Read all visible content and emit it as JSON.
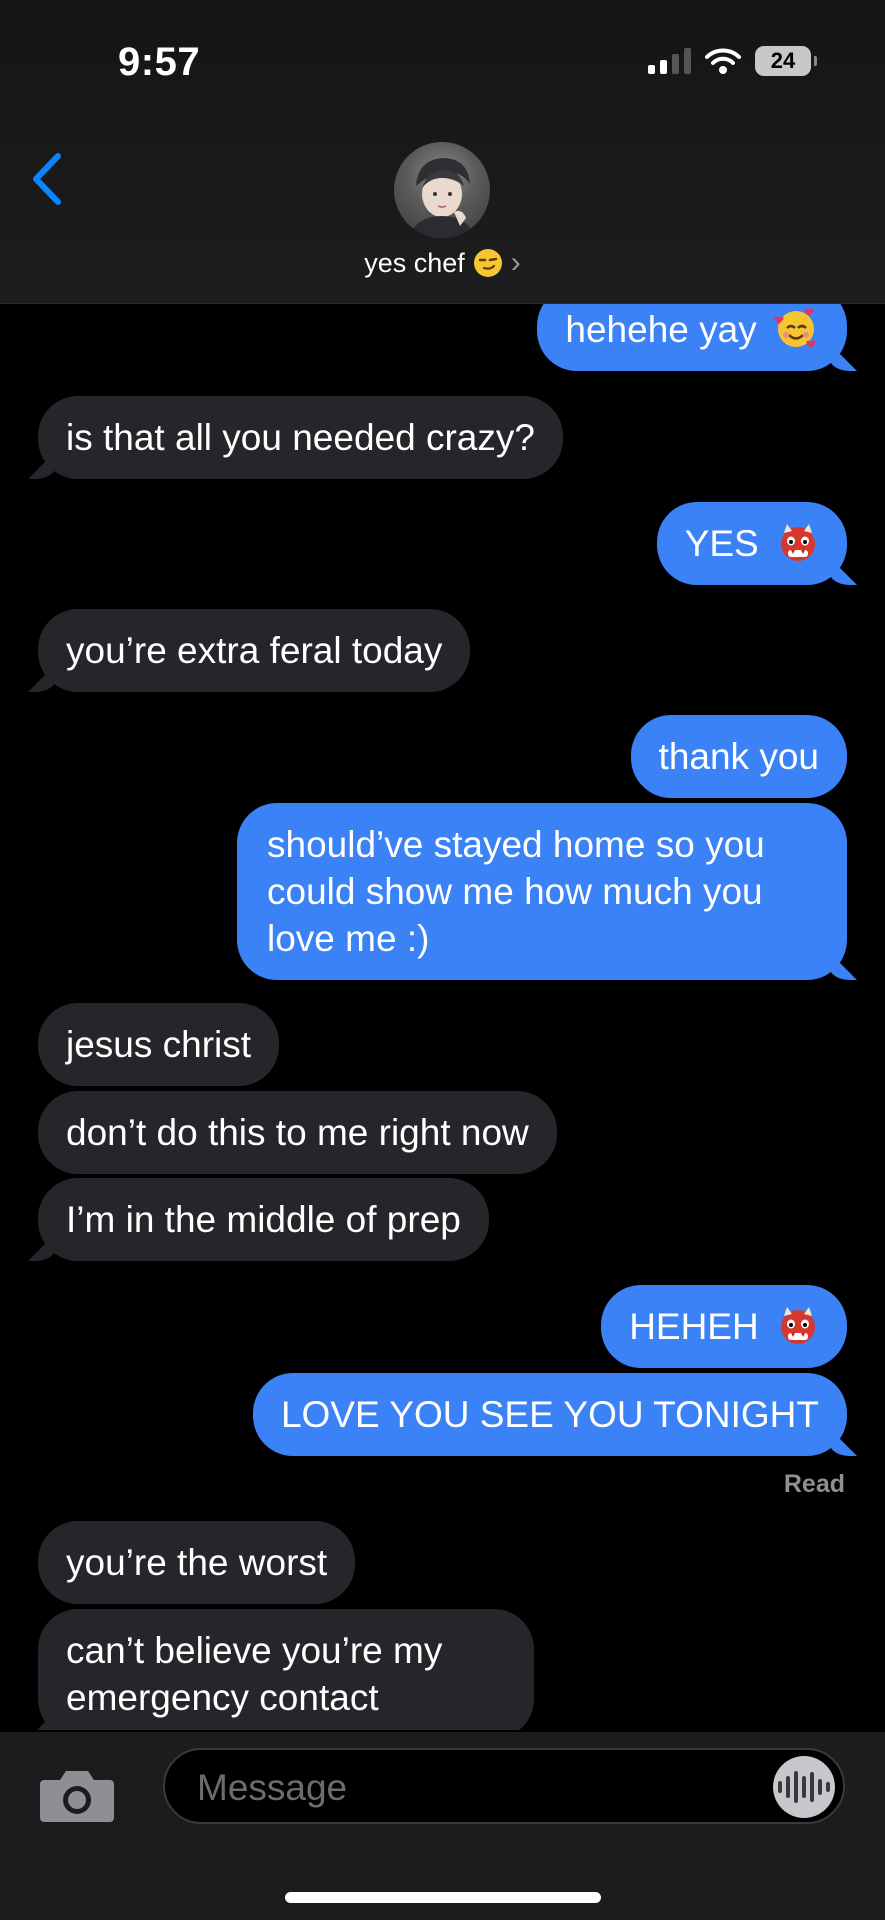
{
  "status_bar": {
    "time": "9:57",
    "battery": "24"
  },
  "header": {
    "contact_name": "yes chef"
  },
  "messages": [
    {
      "from": "me",
      "text": "hehehe yay",
      "emoji": "smiling-face-with-hearts"
    },
    {
      "from": "them",
      "text": "is that all you needed crazy?"
    },
    {
      "from": "me",
      "text": "YES",
      "emoji": "ogre"
    },
    {
      "from": "them",
      "text": "you’re extra feral today"
    },
    {
      "from": "me",
      "text": "thank you"
    },
    {
      "from": "me",
      "text": "should’ve stayed home so you could show me how much you love me :)"
    },
    {
      "from": "them",
      "text": "jesus christ"
    },
    {
      "from": "them",
      "text": "don’t do this to me right now"
    },
    {
      "from": "them",
      "text": "I’m in the middle of prep"
    },
    {
      "from": "me",
      "text": "HEHEH",
      "emoji": "ogre"
    },
    {
      "from": "me",
      "text": "LOVE YOU SEE YOU TONIGHT"
    },
    {
      "from": "them",
      "text": "you’re the worst"
    },
    {
      "from": "them",
      "text": "can’t believe you’re my emergency contact"
    }
  ],
  "read_receipt": "Read",
  "compose": {
    "placeholder": "Message"
  },
  "colors": {
    "outgoing": "#3b82f6",
    "incoming": "#26252a",
    "background": "#000000"
  }
}
